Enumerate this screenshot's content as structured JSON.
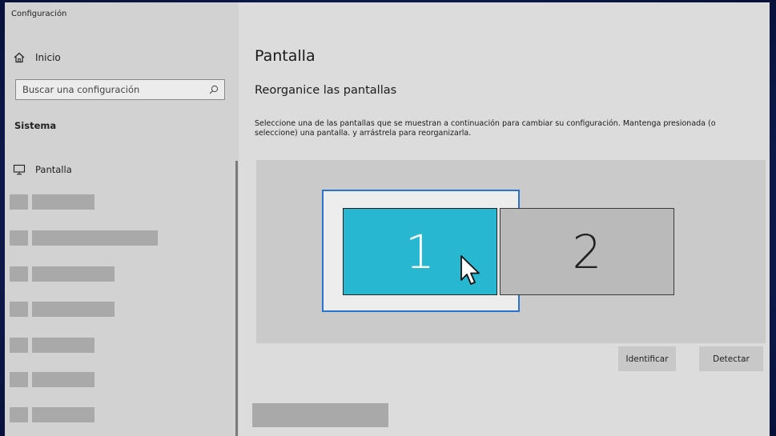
{
  "window": {
    "title": "Configuración"
  },
  "sidebar": {
    "home_label": "Inicio",
    "search_placeholder": "Buscar una configuración",
    "section_label": "Sistema",
    "display_label": "Pantalla",
    "icons": {
      "home": "home-icon",
      "search": "search-icon",
      "display": "monitor-icon"
    }
  },
  "main": {
    "page_title": "Pantalla",
    "section_title": "Reorganice las pantallas",
    "instructions": "Seleccione una de las pantallas que se muestran a continuación para cambiar su configuración. Mantenga presionada (o seleccione) una pantalla. y arrástrela para reorganizarla.",
    "monitors": [
      {
        "label": "1",
        "selected": true,
        "color": "#27b7d1"
      },
      {
        "label": "2",
        "selected": false,
        "color": "#bababa"
      }
    ],
    "selection_color": "#2a72cf",
    "buttons": {
      "identify": "Identificar",
      "detect": "Detectar"
    }
  }
}
